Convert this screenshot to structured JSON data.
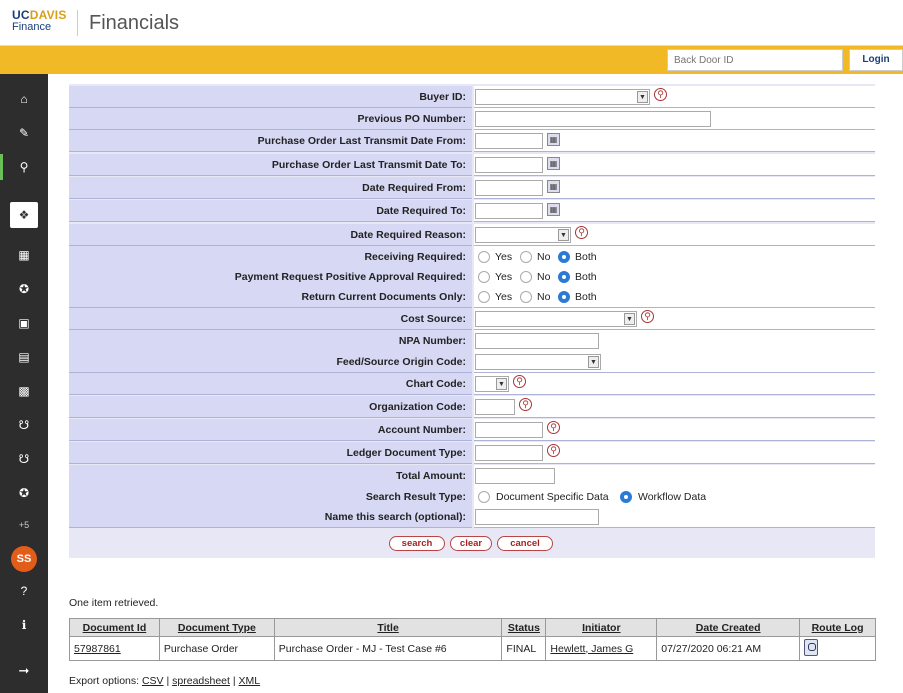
{
  "header": {
    "logo_uc": "UC",
    "logo_davis": "DAVIS",
    "logo_finance": "Finance",
    "app_title": "Financials"
  },
  "goldbar": {
    "backdoor_placeholder": "Back Door ID",
    "login_label": "Login"
  },
  "sidebar": {
    "more_label": "+5",
    "avatar_initials": "SS"
  },
  "form": {
    "rows": [
      {
        "label": "Buyer ID:"
      },
      {
        "label": "Previous PO Number:"
      },
      {
        "label": "Purchase Order Last Transmit Date From:"
      },
      {
        "label": "Purchase Order Last Transmit Date To:"
      },
      {
        "label": "Date Required From:"
      },
      {
        "label": "Date Required To:"
      },
      {
        "label": "Date Required Reason:"
      },
      {
        "label": "Receiving Required:"
      },
      {
        "label": "Payment Request Positive Approval Required:"
      },
      {
        "label": "Return Current Documents Only:"
      },
      {
        "label": "Cost Source:"
      },
      {
        "label": "NPA Number:"
      },
      {
        "label": "Feed/Source Origin Code:"
      },
      {
        "label": "Chart Code:"
      },
      {
        "label": "Organization Code:"
      },
      {
        "label": "Account Number:"
      },
      {
        "label": "Ledger Document Type:"
      },
      {
        "label": "Total Amount:"
      },
      {
        "label": "Search Result Type:"
      },
      {
        "label": "Name this search (optional):"
      }
    ],
    "radio_yes": "Yes",
    "radio_no": "No",
    "radio_both": "Both",
    "result_type_doc": "Document Specific Data",
    "result_type_workflow": "Workflow Data",
    "buttons": {
      "search": "search",
      "clear": "clear",
      "cancel": "cancel"
    }
  },
  "results": {
    "summary": "One item retrieved.",
    "columns": [
      "Document Id",
      "Document Type",
      "Title",
      "Status",
      "Initiator",
      "Date Created",
      "Route Log"
    ],
    "rows": [
      {
        "document_id": "57987861",
        "document_type": "Purchase Order",
        "title": "Purchase Order - MJ - Test Case #6",
        "status": "FINAL",
        "initiator": "Hewlett, James G",
        "date_created": "07/27/2020 06:21 AM"
      }
    ],
    "export_label": "Export options:",
    "export_csv": "CSV",
    "export_spreadsheet": "spreadsheet",
    "export_xml": "XML",
    "export_sep": "|"
  }
}
